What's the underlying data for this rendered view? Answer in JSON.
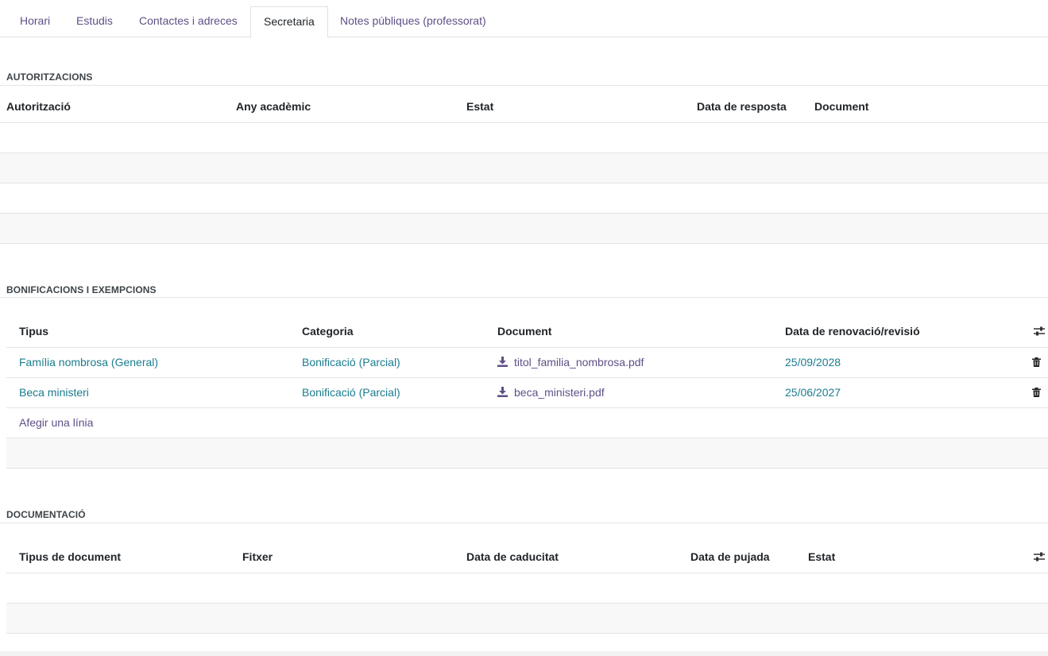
{
  "tabs": [
    {
      "label": "Horari"
    },
    {
      "label": "Estudis"
    },
    {
      "label": "Contactes i adreces"
    },
    {
      "label": "Secretaria"
    },
    {
      "label": "Notes públiques (professorat)"
    }
  ],
  "active_tab": "Secretaria",
  "autoritzacions": {
    "title": "AUTORITZACIONS",
    "columns": [
      "Autorització",
      "Any acadèmic",
      "Estat",
      "Data de resposta",
      "Document"
    ]
  },
  "bonificacions": {
    "title": "BONIFICACIONS I EXEMPCIONS",
    "columns": [
      "Tipus",
      "Categoria",
      "Document",
      "Data de renovació/revisió"
    ],
    "rows": [
      {
        "tipus": "Família nombrosa (General)",
        "categoria": "Bonificació (Parcial)",
        "document": "titol_familia_nombrosa.pdf",
        "data": "25/09/2028"
      },
      {
        "tipus": "Beca ministeri",
        "categoria": "Bonificació (Parcial)",
        "document": "beca_ministeri.pdf",
        "data": "25/06/2027"
      }
    ],
    "add_line": "Afegir una línia"
  },
  "documentacio": {
    "title": "DOCUMENTACIÓ",
    "columns": [
      "Tipus de document",
      "Fitxer",
      "Data de caducitat",
      "Data de pujada",
      "Estat"
    ]
  },
  "icons": {
    "download": "download-icon",
    "delete": "trash-icon",
    "column_settings": "sliders-icon"
  }
}
